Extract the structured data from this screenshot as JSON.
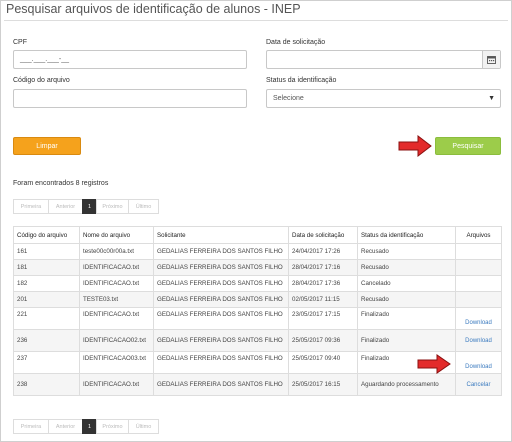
{
  "page": {
    "title": "Pesquisar arquivos de identificação de alunos - INEP"
  },
  "form": {
    "cpf_label": "CPF",
    "cpf_placeholder": "___.___.___-__",
    "data_label": "Data de solicitação",
    "codigo_label": "Código do arquivo",
    "status_label": "Status da identificação",
    "status_selected": "Selecione",
    "limpar_label": "Limpar",
    "pesquisar_label": "Pesquisar"
  },
  "results": {
    "found_text": "Foram encontrados 8 registros"
  },
  "pagination": {
    "first": "Primeira",
    "prev": "Anterior",
    "current": "1",
    "next": "Próximo",
    "last": "Último"
  },
  "table": {
    "headers": [
      "Código do arquivo",
      "Nome do arquivo",
      "Solicitante",
      "Data de solicitação",
      "Status da identificação",
      "Arquivos"
    ],
    "rows": [
      {
        "codigo": "161",
        "nome": "teste00c00r00a.txt",
        "solicitante": "GEDALIAS FERREIRA DOS SANTOS FILHO",
        "data": "24/04/2017 17:26",
        "status": "Recusado",
        "acao": ""
      },
      {
        "codigo": "181",
        "nome": "IDENTIFICACAO.txt",
        "solicitante": "GEDALIAS FERREIRA DOS SANTOS FILHO",
        "data": "28/04/2017 17:16",
        "status": "Recusado",
        "acao": ""
      },
      {
        "codigo": "182",
        "nome": "IDENTIFICACAO.txt",
        "solicitante": "GEDALIAS FERREIRA DOS SANTOS FILHO",
        "data": "28/04/2017 17:36",
        "status": "Cancelado",
        "acao": ""
      },
      {
        "codigo": "201",
        "nome": "TESTE03.txt",
        "solicitante": "GEDALIAS FERREIRA DOS SANTOS FILHO",
        "data": "02/05/2017 11:15",
        "status": "Recusado",
        "acao": ""
      },
      {
        "codigo": "221",
        "nome": "IDENTIFICACAO.txt",
        "solicitante": "GEDALIAS FERREIRA DOS SANTOS FILHO",
        "data": "23/05/2017 17:15",
        "status": "Finalizado",
        "acao": "Download"
      },
      {
        "codigo": "236",
        "nome": "IDENTIFICACAO02.txt",
        "solicitante": "GEDALIAS FERREIRA DOS SANTOS FILHO",
        "data": "25/05/2017 09:36",
        "status": "Finalizado",
        "acao": "Download"
      },
      {
        "codigo": "237",
        "nome": "IDENTIFICACAO03.txt",
        "solicitante": "GEDALIAS FERREIRA DOS SANTOS FILHO",
        "data": "25/05/2017 09:40",
        "status": "Finalizado",
        "acao": "Download"
      },
      {
        "codigo": "238",
        "nome": "IDENTIFICACAO.txt",
        "solicitante": "GEDALIAS FERREIRA DOS SANTOS FILHO",
        "data": "25/05/2017 16:15",
        "status": "Aguardando processamento",
        "acao": "Cancelar"
      }
    ]
  },
  "colors": {
    "limpar": "#f5a21c",
    "pesquisar": "#9ccc4a",
    "link": "#3a7abf",
    "arrow": "#e32b2b"
  },
  "icons": {
    "calendar": "calendar-icon",
    "caret": "caret-down-icon",
    "arrow": "red-arrow-icon"
  }
}
